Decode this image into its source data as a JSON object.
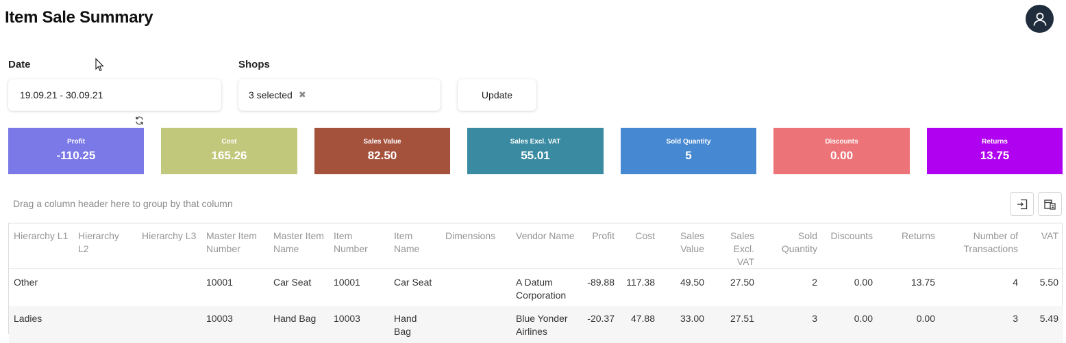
{
  "page": {
    "title": "Item Sale Summary"
  },
  "filters": {
    "date_label": "Date",
    "date_value": "19.09.21 - 30.09.21",
    "shops_label": "Shops",
    "shops_value": "3 selected",
    "update_label": "Update"
  },
  "kpis": [
    {
      "label": "Profit",
      "value": "-110.25",
      "color": "#7b78e7"
    },
    {
      "label": "Cost",
      "value": "165.26",
      "color": "#c1c87c"
    },
    {
      "label": "Sales Value",
      "value": "82.50",
      "color": "#a5523d"
    },
    {
      "label": "Sales Excl. VAT",
      "value": "55.01",
      "color": "#3a8ba1"
    },
    {
      "label": "Sold Quantity",
      "value": "5",
      "color": "#4688d1"
    },
    {
      "label": "Discounts",
      "value": "0.00",
      "color": "#ec7479"
    },
    {
      "label": "Returns",
      "value": "13.75",
      "color": "#b002f0"
    }
  ],
  "grid": {
    "group_hint": "Drag a column header here to group by that column",
    "columns": [
      [
        "Hierarchy L1"
      ],
      [
        "Hierarchy L2"
      ],
      [
        "Hierarchy L3"
      ],
      [
        "Master Item",
        "Number"
      ],
      [
        "Master Item",
        "Name"
      ],
      [
        "Item",
        "Number"
      ],
      [
        "Item",
        "Name"
      ],
      [
        "Dimensions"
      ],
      [
        "Vendor Name"
      ],
      [
        "Profit"
      ],
      [
        "Cost"
      ],
      [
        "Sales",
        "Value"
      ],
      [
        "Sales",
        "Excl. VAT"
      ],
      [
        "Sold",
        "Quantity"
      ],
      [
        "Discounts"
      ],
      [
        "Returns"
      ],
      [
        "Number of",
        "Transactions"
      ],
      [
        "VAT"
      ]
    ],
    "rows": [
      [
        "Other",
        "",
        "",
        "10001",
        "Car Seat",
        "10001",
        "Car Seat",
        "",
        [
          "A Datum",
          "Corporation"
        ],
        "-89.88",
        "117.38",
        "49.50",
        "27.50",
        "2",
        "0.00",
        "13.75",
        "4",
        "5.50"
      ],
      [
        "Ladies",
        "",
        "",
        "10003",
        "Hand Bag",
        "10003",
        "Hand Bag",
        "",
        [
          "Blue Yonder",
          "Airlines"
        ],
        "-20.37",
        "47.88",
        "33.00",
        "27.51",
        "3",
        "0.00",
        "0.00",
        "3",
        "5.49"
      ]
    ]
  },
  "icons": {
    "avatar": "user-icon",
    "refresh": "refresh-icon",
    "clear": "close-icon",
    "export": "export-icon",
    "column_chooser": "column-chooser-icon"
  }
}
